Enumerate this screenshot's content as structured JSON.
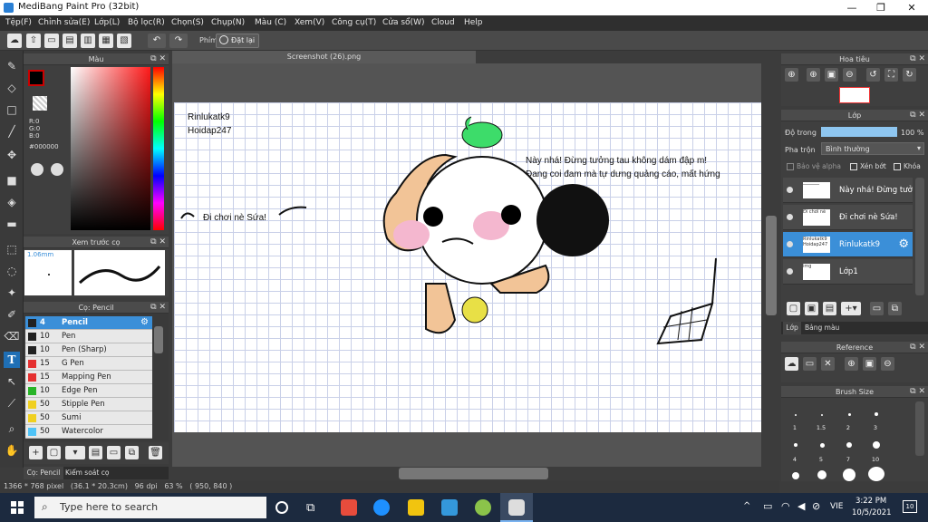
{
  "window": {
    "title": "MediBang Paint Pro (32bit)",
    "controls": [
      "—",
      "❐",
      "✕"
    ]
  },
  "menu": [
    "Tệp(F)",
    "Chỉnh sửa(E)",
    "Lớp(L)",
    "Bộ lọc(R)",
    "Chọn(S)",
    "Chụp(N)",
    "Màu (C)",
    "Xem(V)",
    "Công cụ(T)",
    "Cửa sổ(W)",
    "Cloud",
    "Help"
  ],
  "toolbar": {
    "key_label": "Phím",
    "reset_label": "Đặt lại"
  },
  "color_panel": {
    "title": "Màu",
    "r": "R:0",
    "g": "G:0",
    "b": "B:0",
    "hex": "#000000"
  },
  "preview_panel": {
    "title": "Xem trước cọ",
    "size": "1.06mm"
  },
  "brush_panel": {
    "title": "Cọ: Pencil",
    "brushes": [
      {
        "size": "4",
        "name": "Pencil",
        "color": "#222222"
      },
      {
        "size": "10",
        "name": "Pen",
        "color": "#222222"
      },
      {
        "size": "10",
        "name": "Pen (Sharp)",
        "color": "#222222"
      },
      {
        "size": "15",
        "name": "G Pen",
        "color": "#e53030"
      },
      {
        "size": "15",
        "name": "Mapping Pen",
        "color": "#e53030"
      },
      {
        "size": "10",
        "name": "Edge Pen",
        "color": "#28b428"
      },
      {
        "size": "50",
        "name": "Stipple Pen",
        "color": "#f0d020"
      },
      {
        "size": "50",
        "name": "Sumi",
        "color": "#f0d020"
      },
      {
        "size": "50",
        "name": "Watercolor",
        "color": "#4fc3f7"
      }
    ],
    "tabs": [
      "Cọ: Pencil",
      "Kiểm soát cọ"
    ]
  },
  "document_tab": "Screenshot (26).png",
  "canvas_text": {
    "credit1": "Rinlukatk9",
    "credit2": "Hoidap247",
    "speech_left": "Đi chơi nè Sứa!",
    "speech_right1": "Này nhá! Đừng tưởng tau không dám đập m!",
    "speech_right2": "Đang coi đam mà tự dưng quảng cáo, mất hứng"
  },
  "navigator": {
    "title": "Hoa tiêu"
  },
  "layer_panel": {
    "title": "Lớp",
    "opacity_label": "Độ trong",
    "opacity_value": "100 %",
    "blend_label": "Pha trộn",
    "blend_value": "Bình thường",
    "protect_alpha": "Bảo vệ alpha",
    "clipping": "Xén bớt",
    "lock": "Khóa",
    "layers": [
      {
        "name": "Này nhá! Đừng tưở",
        "thumb": "──────",
        "selected": false
      },
      {
        "name": "Đi chơi nè Sứa!",
        "thumb": "Đi chơi nè",
        "selected": false
      },
      {
        "name": "Rinlukatk9",
        "thumb": "Rinlukatk9 Hoidap247",
        "selected": true
      },
      {
        "name": "Lớp1",
        "thumb": "img",
        "selected": false
      }
    ],
    "tabs": [
      "Lớp",
      "Bảng màu"
    ]
  },
  "reference_panel": {
    "title": "Reference"
  },
  "brush_size_panel": {
    "title": "Brush Size",
    "row1": [
      "1",
      "1.5",
      "2",
      "3"
    ],
    "row2": [
      "4",
      "5",
      "7",
      "10"
    ]
  },
  "status": "1366 * 768 pixel   (36.1 * 20.3cm)   96 dpi   63 %   ( 950, 840 )",
  "taskbar": {
    "search_placeholder": "Type here to search",
    "lang": "VIE",
    "time": "3:22 PM",
    "date": "10/5/2021",
    "notif": "10"
  }
}
